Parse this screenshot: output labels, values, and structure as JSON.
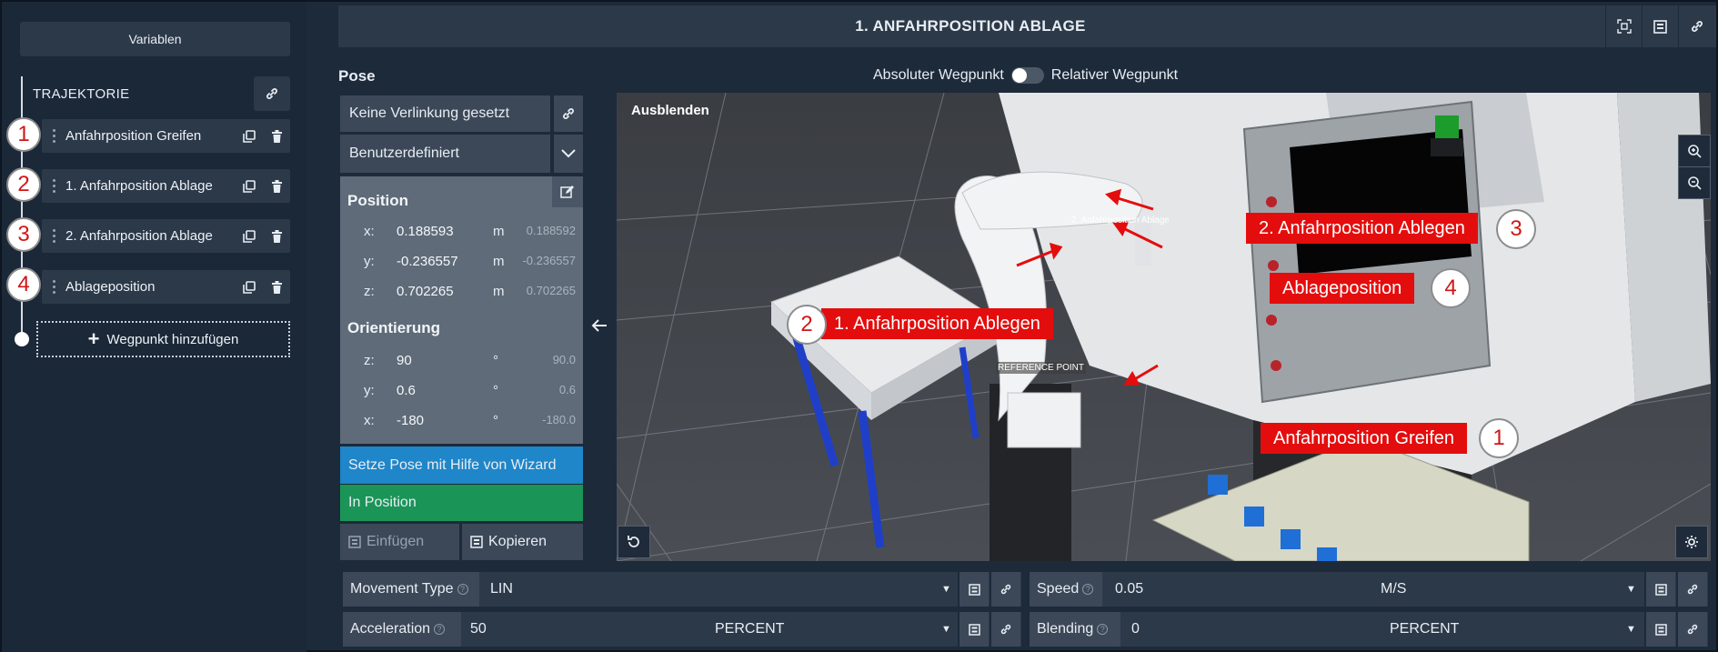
{
  "sidebar": {
    "variables_label": "Variablen",
    "trajectory_title": "TRAJEKTORIE",
    "waypoints": [
      {
        "number": "1",
        "label": "Anfahrposition Greifen"
      },
      {
        "number": "2",
        "label": "1. Anfahrposition Ablage"
      },
      {
        "number": "3",
        "label": "2. Anfahrposition Ablage"
      },
      {
        "number": "4",
        "label": "Ablageposition"
      }
    ],
    "add_waypoint_label": "Wegpunkt hinzufügen"
  },
  "header": {
    "title": "1. ANFAHRPOSITION ABLAGE"
  },
  "pose": {
    "title": "Pose",
    "toggle_left": "Absoluter Wegpunkt",
    "toggle_right": "Relativer Wegpunkt",
    "link_status": "Keine Verlinkung gesetzt",
    "frame_select": "Benutzerdefiniert",
    "position_title": "Position",
    "position": [
      {
        "axis": "x:",
        "value": "0.188593",
        "unit": "m",
        "ghost": "0.188592"
      },
      {
        "axis": "y:",
        "value": "-0.236557",
        "unit": "m",
        "ghost": "-0.236557"
      },
      {
        "axis": "z:",
        "value": "0.702265",
        "unit": "m",
        "ghost": "0.702265"
      }
    ],
    "orientation_title": "Orientierung",
    "orientation": [
      {
        "axis": "z:",
        "value": "90",
        "unit": "°",
        "ghost": "90.0"
      },
      {
        "axis": "y:",
        "value": "0.6",
        "unit": "°",
        "ghost": "0.6"
      },
      {
        "axis": "x:",
        "value": "-180",
        "unit": "°",
        "ghost": "-180.0"
      }
    ],
    "wizard_label": "Setze Pose mit Hilfe von Wizard",
    "in_position_label": "In Position",
    "insert_label": "Einfügen",
    "copy_label": "Kopieren"
  },
  "viewport": {
    "hide_label": "Ausblenden",
    "scene_label_reference": "REFERENCE POINT",
    "scene_label_ablage": "2. Anfahrposition Ablage",
    "callouts": [
      {
        "number": "3",
        "label": "2. Anfahrposition Ablegen"
      },
      {
        "number": "4",
        "label": "Ablageposition"
      },
      {
        "number": "2",
        "label": "1. Anfahrposition Ablegen"
      },
      {
        "number": "1",
        "label": "Anfahrposition Greifen"
      }
    ]
  },
  "params": {
    "movement_type": {
      "label": "Movement Type",
      "value": "LIN"
    },
    "speed": {
      "label": "Speed",
      "value": "0.05",
      "unit": "M/S"
    },
    "acceleration": {
      "label": "Acceleration",
      "value": "50",
      "unit": "PERCENT"
    },
    "blending": {
      "label": "Blending",
      "value": "0",
      "unit": "PERCENT"
    }
  },
  "colors": {
    "background": "#1d2a3a",
    "panel": "#2c3949",
    "wizard_blue": "#1e86c9",
    "in_position_green": "#1a9557",
    "callout_red": "#e40d0d"
  }
}
